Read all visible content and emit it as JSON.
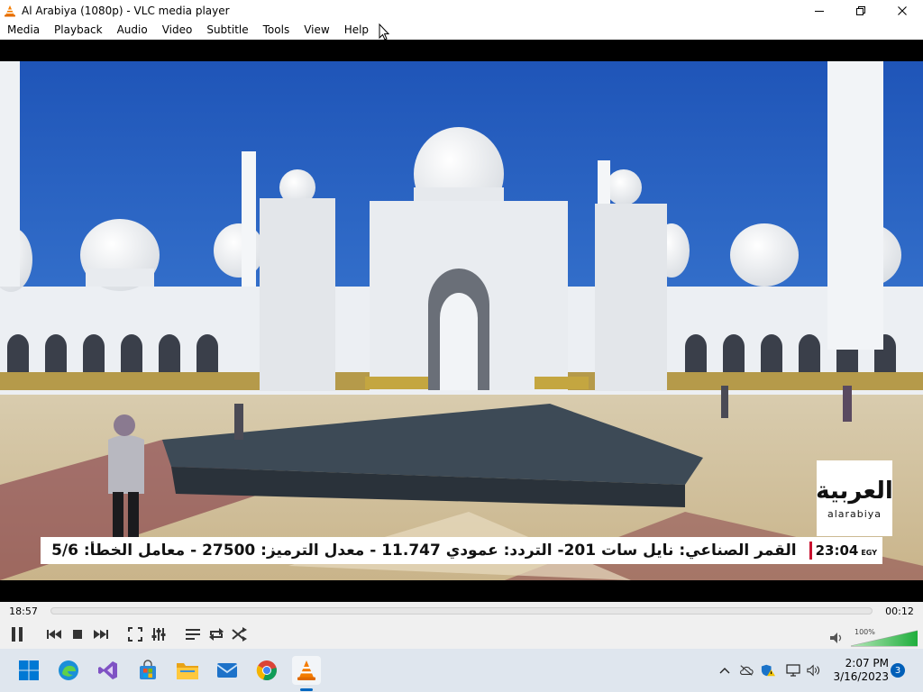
{
  "window": {
    "title": "Al Arabiya (1080p) - VLC media player"
  },
  "menu": [
    "Media",
    "Playback",
    "Audio",
    "Video",
    "Subtitle",
    "Tools",
    "View",
    "Help"
  ],
  "video": {
    "logo_arabic": "العربية",
    "logo_latin": "alarabiya",
    "ticker_text": "القمر الصناعي: نايل سات 201- التردد: عمودي 11.747 - معدل الترميز: 27500 - معامل الخطأ: 5/6",
    "ticker_time": "23:04",
    "ticker_zone": "EGY"
  },
  "seek": {
    "elapsed": "18:57",
    "remaining": "00:12",
    "progress": 0.0
  },
  "volume": {
    "percent_label": "100%",
    "level": 1.0
  },
  "controls": {
    "icons": [
      "pause-icon",
      "previous-icon",
      "stop-icon",
      "next-icon",
      "fullscreen-icon",
      "extended-settings-icon",
      "playlist-icon",
      "loop-icon",
      "shuffle-icon",
      "volume-icon"
    ]
  },
  "taskbar": {
    "apps": [
      "start-icon",
      "edge-icon",
      "visual-studio-icon",
      "store-icon",
      "file-explorer-icon",
      "mail-icon",
      "chrome-icon",
      "vlc-icon"
    ],
    "time": "2:07 PM",
    "date": "3/16/2023",
    "notification_count": "3"
  },
  "colors": {
    "accent": "#0067c0",
    "volume_green": "#2fb84a",
    "ticker_red": "#c8102e"
  }
}
